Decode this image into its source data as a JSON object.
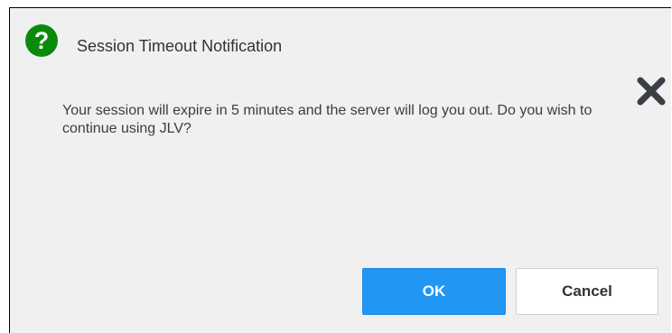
{
  "dialog": {
    "title": "Session Timeout Notification",
    "message": "Your session will expire in 5 minutes and the server will log you out. Do you wish to continue using JLV?",
    "ok_label": "OK",
    "cancel_label": "Cancel"
  },
  "icons": {
    "help": "help-icon",
    "close": "close-icon"
  },
  "colors": {
    "help_icon": "#0a8a0a",
    "primary_button": "#2196f3",
    "background": "#f0f0f0",
    "close_icon": "#3a3f45"
  }
}
